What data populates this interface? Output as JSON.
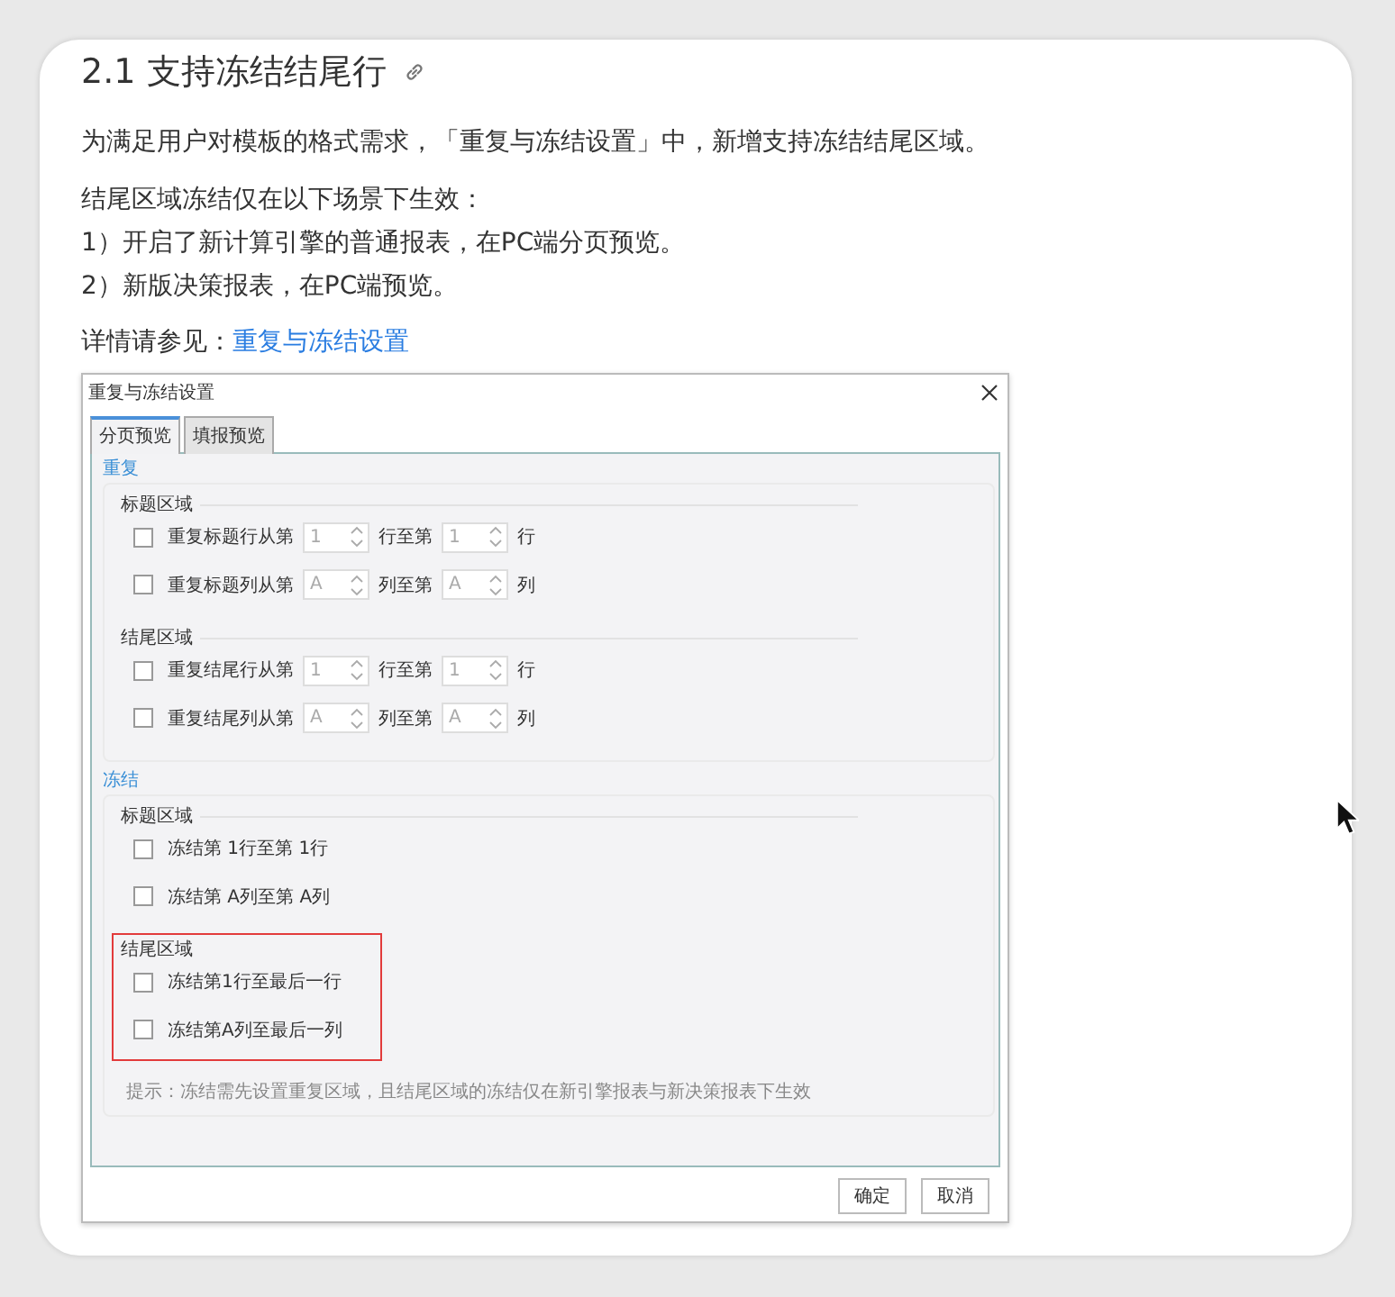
{
  "heading": "2.1 支持冻结结尾行",
  "intro": "为满足用户对模板的格式需求，「重复与冻结设置」中，新增支持冻结结尾区域。",
  "conditions_title": "结尾区域冻结仅在以下场景下生效：",
  "conditions": [
    "1）开启了新计算引擎的普通报表，在PC端分页预览。",
    "2）新版决策报表，在PC端预览。"
  ],
  "see_also": {
    "label": "详情请参见：",
    "link": "重复与冻结设置"
  },
  "dialog": {
    "title": "重复与冻结设置",
    "tabs": [
      {
        "label": "分页预览",
        "selected": true
      },
      {
        "label": "填报预览",
        "selected": false
      }
    ],
    "groups": [
      {
        "legend": "重复",
        "sections": [
          {
            "title": "标题区域",
            "highlighted": false,
            "rows": [
              {
                "kind": "spinner",
                "checked": false,
                "label": "重复标题行从第",
                "from_value": "1",
                "mid_label": "行至第",
                "to_value": "1",
                "end_label": "行"
              },
              {
                "kind": "spinner",
                "checked": false,
                "label": "重复标题列从第",
                "from_value": "A",
                "mid_label": "列至第",
                "to_value": "A",
                "end_label": "列"
              }
            ]
          },
          {
            "title": "结尾区域",
            "highlighted": false,
            "rows": [
              {
                "kind": "spinner",
                "checked": false,
                "label": "重复结尾行从第",
                "from_value": "1",
                "mid_label": "行至第",
                "to_value": "1",
                "end_label": "行"
              },
              {
                "kind": "spinner",
                "checked": false,
                "label": "重复结尾列从第",
                "from_value": "A",
                "mid_label": "列至第",
                "to_value": "A",
                "end_label": "列"
              }
            ]
          }
        ]
      },
      {
        "legend": "冻结",
        "sections": [
          {
            "title": "标题区域",
            "highlighted": false,
            "rows": [
              {
                "kind": "plain",
                "checked": false,
                "label": "冻结第 1行至第 1行"
              },
              {
                "kind": "plain",
                "checked": false,
                "label": "冻结第 A列至第 A列"
              }
            ]
          },
          {
            "title": "结尾区域",
            "highlighted": true,
            "rows": [
              {
                "kind": "plain",
                "checked": false,
                "label": "冻结第1行至最后一行"
              },
              {
                "kind": "plain",
                "checked": false,
                "label": "冻结第A列至最后一列"
              }
            ]
          }
        ],
        "hint": "提示：冻结需先设置重复区域，且结尾区域的冻结仅在新引擎报表与新决策报表下生效"
      }
    ],
    "buttons": [
      "确定",
      "取消"
    ]
  }
}
